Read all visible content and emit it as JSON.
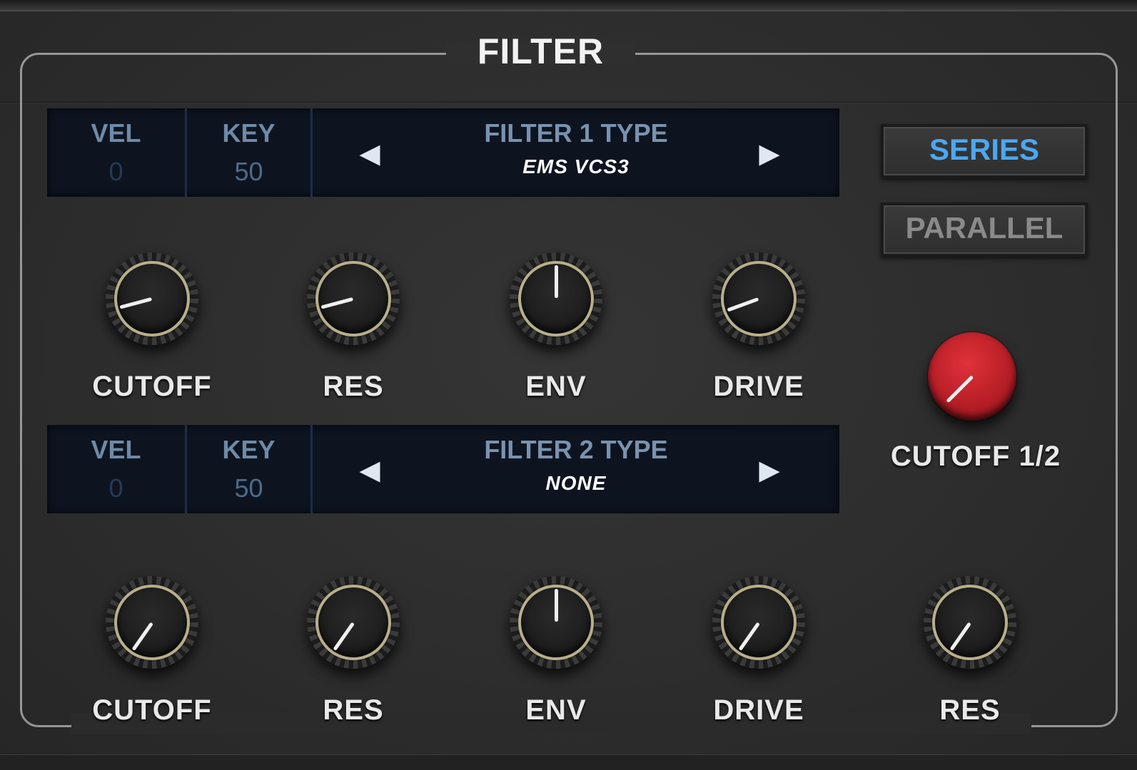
{
  "section": {
    "title": "FILTER"
  },
  "filter1": {
    "vel_label": "VEL",
    "vel_value": "0",
    "key_label": "KEY",
    "key_value": "50",
    "type_label": "FILTER 1 TYPE",
    "type_value": "EMS VCS3",
    "knobs": [
      {
        "label": "CUTOFF",
        "angle_deg": -105
      },
      {
        "label": "RES",
        "angle_deg": -105
      },
      {
        "label": "ENV",
        "angle_deg": 0
      },
      {
        "label": "DRIVE",
        "angle_deg": -110
      }
    ]
  },
  "filter2": {
    "vel_label": "VEL",
    "vel_value": "0",
    "key_label": "KEY",
    "key_value": "50",
    "type_label": "FILTER 2 TYPE",
    "type_value": "NONE",
    "knobs": [
      {
        "label": "CUTOFF",
        "angle_deg": -145
      },
      {
        "label": "RES",
        "angle_deg": -145
      },
      {
        "label": "ENV",
        "angle_deg": 0
      },
      {
        "label": "DRIVE",
        "angle_deg": -145
      },
      {
        "label": "RES",
        "angle_deg": -145
      }
    ]
  },
  "routing": {
    "series_label": "SERIES",
    "parallel_label": "PARALLEL",
    "active": "SERIES",
    "active_color": "#4aa8f2"
  },
  "cutoff_link": {
    "label": "CUTOFF 1/2",
    "angle_deg": -135,
    "color": "#c4222b"
  },
  "icons": {
    "prev": "◀",
    "next": "▶"
  }
}
